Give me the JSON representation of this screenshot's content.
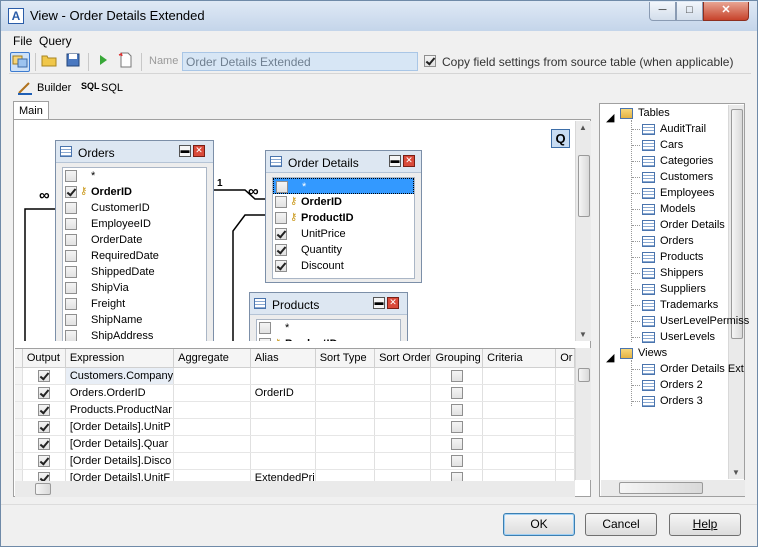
{
  "window": {
    "title": "View - Order Details Extended",
    "minimize": "─",
    "maximize": "□",
    "close": "✕"
  },
  "menu": [
    {
      "label": "File"
    },
    {
      "label": "Query"
    }
  ],
  "toolbar": {
    "name_label": "Name",
    "name_value": "Order Details Extended",
    "copy_label": "Copy field settings from source table (when applicable)",
    "copy_checked": true
  },
  "view_tabs": {
    "builder": "Builder",
    "sql": "SQL",
    "sql_icon": "SQL"
  },
  "main_tab": "Main",
  "q_button": "Q",
  "tables": [
    {
      "name": "Orders",
      "fields": [
        {
          "name": "*",
          "checked": false,
          "key": false,
          "bold": false
        },
        {
          "name": "OrderID",
          "checked": true,
          "key": true,
          "bold": true
        },
        {
          "name": "CustomerID",
          "checked": false,
          "key": false,
          "bold": false
        },
        {
          "name": "EmployeeID",
          "checked": false,
          "key": false,
          "bold": false
        },
        {
          "name": "OrderDate",
          "checked": false,
          "key": false,
          "bold": false
        },
        {
          "name": "RequiredDate",
          "checked": false,
          "key": false,
          "bold": false
        },
        {
          "name": "ShippedDate",
          "checked": false,
          "key": false,
          "bold": false
        },
        {
          "name": "ShipVia",
          "checked": false,
          "key": false,
          "bold": false
        },
        {
          "name": "Freight",
          "checked": false,
          "key": false,
          "bold": false
        },
        {
          "name": "ShipName",
          "checked": false,
          "key": false,
          "bold": false
        },
        {
          "name": "ShipAddress",
          "checked": false,
          "key": false,
          "bold": false
        }
      ]
    },
    {
      "name": "Order Details",
      "fields": [
        {
          "name": "*",
          "checked": false,
          "key": false,
          "bold": false,
          "selected": true
        },
        {
          "name": "OrderID",
          "checked": false,
          "key": true,
          "bold": true
        },
        {
          "name": "ProductID",
          "checked": false,
          "key": true,
          "bold": true
        },
        {
          "name": "UnitPrice",
          "checked": true,
          "key": false,
          "bold": false
        },
        {
          "name": "Quantity",
          "checked": true,
          "key": false,
          "bold": false
        },
        {
          "name": "Discount",
          "checked": true,
          "key": false,
          "bold": false
        }
      ]
    },
    {
      "name": "Products",
      "fields": [
        {
          "name": "*",
          "checked": false,
          "key": false,
          "bold": false
        },
        {
          "name": "ProductID",
          "checked": false,
          "key": true,
          "bold": true
        }
      ]
    }
  ],
  "relations": {
    "many": "∞",
    "one": "1"
  },
  "grid": {
    "columns": [
      "Output",
      "Expression",
      "Aggregate",
      "Alias",
      "Sort Type",
      "Sort Order",
      "Grouping",
      "Criteria",
      "Or"
    ],
    "rows": [
      {
        "output": true,
        "expression": "Customers.Company",
        "alias": "",
        "grouping": false
      },
      {
        "output": true,
        "expression": "Orders.OrderID",
        "alias": "OrderID",
        "grouping": false
      },
      {
        "output": true,
        "expression": "Products.ProductNar",
        "alias": "",
        "grouping": false
      },
      {
        "output": true,
        "expression": "[Order Details].UnitP",
        "alias": "",
        "grouping": false
      },
      {
        "output": true,
        "expression": "[Order Details].Quar",
        "alias": "",
        "grouping": false
      },
      {
        "output": true,
        "expression": "[Order Details].Disco",
        "alias": "",
        "grouping": false
      },
      {
        "output": true,
        "expression": "[Order Details].UnitF",
        "alias": "ExtendedPri",
        "grouping": false
      }
    ]
  },
  "tree": {
    "tables_label": "Tables",
    "tables": [
      "AuditTrail",
      "Cars",
      "Categories",
      "Customers",
      "Employees",
      "Models",
      "Order Details",
      "Orders",
      "Products",
      "Shippers",
      "Suppliers",
      "Trademarks",
      "UserLevelPermiss",
      "UserLevels"
    ],
    "views_label": "Views",
    "views": [
      "Order Details Ext",
      "Orders 2",
      "Orders 3"
    ]
  },
  "buttons": {
    "ok": "OK",
    "cancel": "Cancel",
    "help": "Help"
  }
}
